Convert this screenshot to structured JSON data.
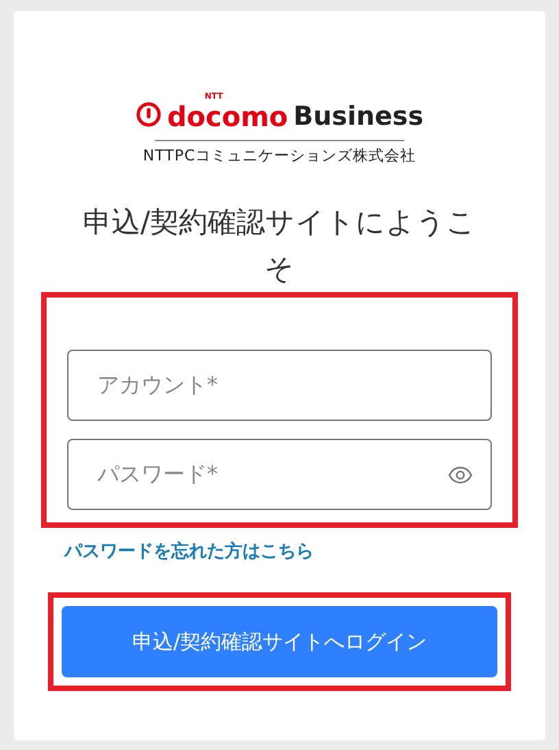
{
  "logo": {
    "tag": "NTT",
    "brand": "docomo",
    "product": "Business",
    "company": "NTTPCコミュニケーションズ株式会社"
  },
  "title": "申込/契約確認サイトにようこそ",
  "form": {
    "highlighted": true,
    "fields": [
      {
        "kind": "text",
        "placeholder": "アカウント*"
      },
      {
        "kind": "password",
        "placeholder": "パスワード*"
      }
    ]
  },
  "forgot_link": "パスワードを忘れた方はこちら",
  "login_button": {
    "label": "申込/契約確認サイトへログイン",
    "highlighted": true
  }
}
